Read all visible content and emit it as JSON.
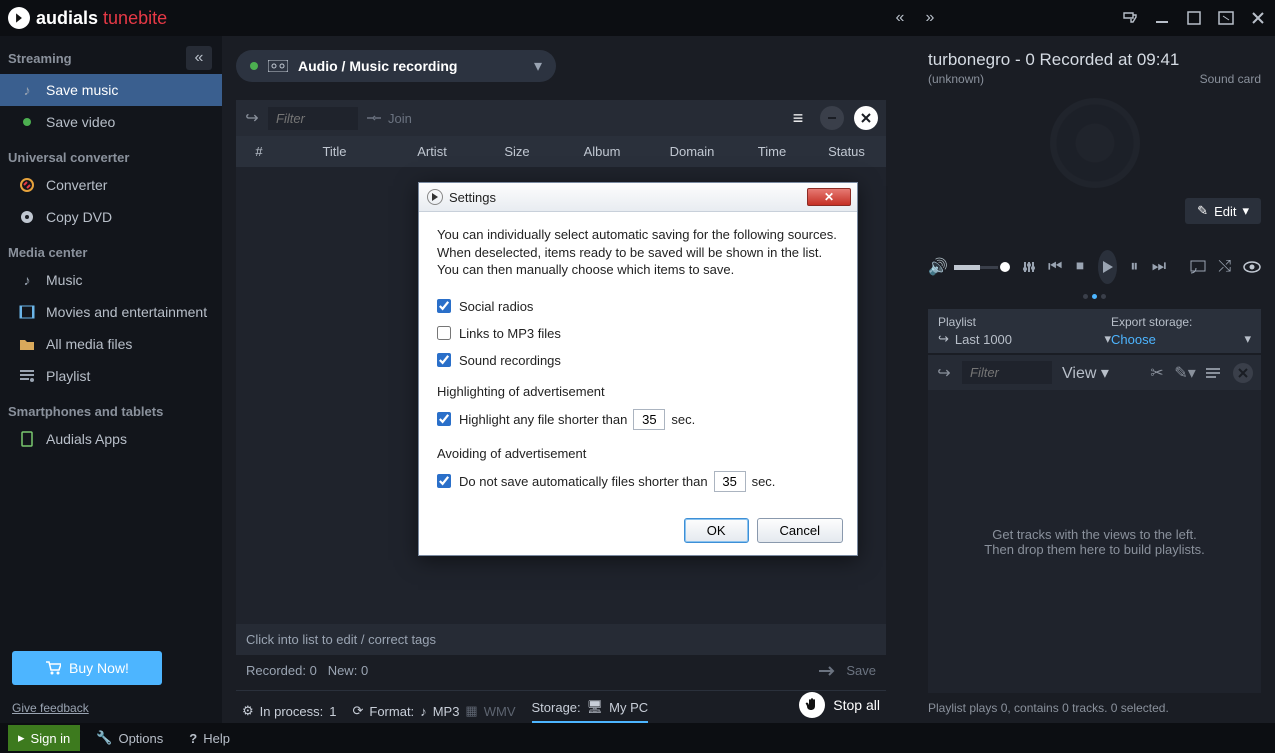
{
  "titlebar": {
    "brand1": "audials",
    "brand2": "tunebite"
  },
  "sidebar": {
    "streaming_label": "Streaming",
    "save_music": "Save music",
    "save_video": "Save video",
    "converter_label": "Universal converter",
    "converter": "Converter",
    "copydvd": "Copy DVD",
    "mediacenter_label": "Media center",
    "music": "Music",
    "movies": "Movies and entertainment",
    "allmedia": "All media files",
    "playlist": "Playlist",
    "smart_label": "Smartphones and tablets",
    "apps": "Audials Apps",
    "buy": "Buy Now!",
    "feedback": "Give feedback"
  },
  "main": {
    "mode": "Audio / Music recording",
    "filter_ph": "Filter",
    "join": "Join",
    "cols": {
      "num": "#",
      "title": "Title",
      "artist": "Artist",
      "size": "Size",
      "album": "Album",
      "domain": "Domain",
      "time": "Time",
      "status": "Status"
    },
    "listfoot": "Click into list to edit / correct tags",
    "recorded_label": "Recorded:",
    "recorded_val": "0",
    "new_label": "New:",
    "new_val": "0",
    "save": "Save",
    "status": {
      "inprocess_l": "In process:",
      "inprocess_v": "1",
      "format_l": "Format:",
      "mp3": "MP3",
      "wmv": "WMV",
      "storage_l": "Storage:",
      "storage_v": "My PC"
    },
    "stopall": "Stop all"
  },
  "right": {
    "np_title": "turbonegro - 0 Recorded at 09:41",
    "np_sub_l": "(unknown)",
    "np_sub_r": "Sound card",
    "edit": "Edit",
    "pl_label": "Playlist",
    "pl_val": "Last 1000",
    "export_label": "Export storage:",
    "export_val": "Choose",
    "filter_ph": "Filter",
    "view": "View",
    "hint1": "Get tracks with the views to the left.",
    "hint2": "Then drop them here to build playlists.",
    "footer": "Playlist plays 0, contains 0 tracks. 0 selected."
  },
  "bottom": {
    "signin": "Sign in",
    "options": "Options",
    "help": "Help"
  },
  "dialog": {
    "title": "Settings",
    "intro": "You can individually select automatic saving for the following sources. When deselected, items ready to be saved will be shown in the list. You can then manually choose which items to save.",
    "c1": "Social radios",
    "c2": "Links to MP3 files",
    "c3": "Sound recordings",
    "sub1": "Highlighting of advertisement",
    "hl_label": "Highlight any file shorter than",
    "hl_val": "35",
    "sec": "sec.",
    "sub2": "Avoiding of advertisement",
    "av_label": "Do not save automatically files shorter than",
    "av_val": "35",
    "ok": "OK",
    "cancel": "Cancel"
  }
}
